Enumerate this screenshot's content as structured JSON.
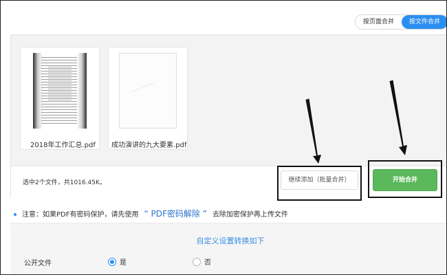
{
  "mode_toggle": {
    "by_page": "按页面合并",
    "by_file": "按文件合并",
    "active": "by_file"
  },
  "files": [
    {
      "name": "2018年工作汇总.pdf",
      "thumbnail": "document-thumbnail"
    },
    {
      "name": "成功演讲的九大要素.pdf",
      "thumbnail": "blank-page-thumbnail"
    }
  ],
  "footer": {
    "summary": "选中2个文件，共1016.45K。",
    "add_button": "继续添加（批量合并）",
    "start_button": "开始合并"
  },
  "notice": {
    "prefix": "注意：如果PDF有密码保护，请先使用",
    "link": "“ PDF密码解除 ”",
    "suffix": "去除加密保护再上传文件"
  },
  "settings": {
    "title": "自定义设置转换如下",
    "public_label": "公开文件",
    "options": [
      {
        "label": "是",
        "selected": true
      },
      {
        "label": "否",
        "selected": false
      }
    ]
  },
  "colors": {
    "accent": "#2b8ef0",
    "start_green": "#5bb85b",
    "link_blue": "#2a73c9"
  }
}
